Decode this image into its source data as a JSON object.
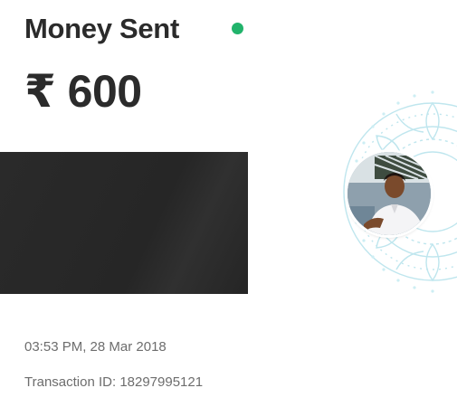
{
  "header": {
    "title": "Money Sent",
    "status_color": "#21b36b"
  },
  "amount": {
    "text": "₹ 600"
  },
  "recipient": {
    "avatar_icon": "profile-photo"
  },
  "details": {
    "timestamp": "03:53 PM, 28 Mar 2018",
    "transaction_id": "Transaction ID: 18297995121"
  },
  "colors": {
    "text_primary": "#2b2b2b",
    "text_secondary": "#6d6d6d",
    "mandala": "#bfe6ee"
  }
}
